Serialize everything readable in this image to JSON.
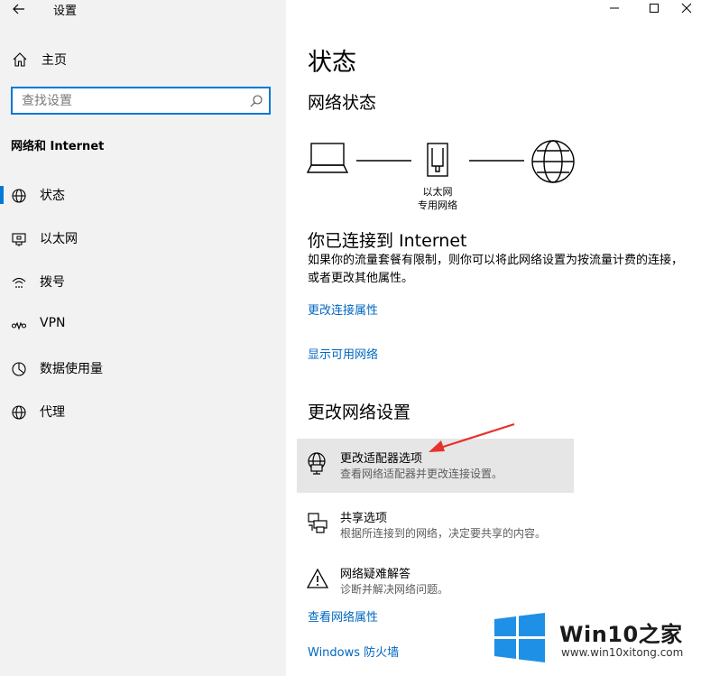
{
  "app": {
    "title": "设置"
  },
  "colors": {
    "accent": "#0078d7",
    "link": "#0067c0",
    "sidebar_bg": "#f2f2f2",
    "highlight_bg": "#e6e6e6",
    "arrow": "#e5322d"
  },
  "sidebar": {
    "home_label": "主页",
    "search_placeholder": "查找设置",
    "section_title": "网络和 Internet",
    "items": [
      {
        "label": "状态",
        "icon": "globe-status-icon",
        "selected": true
      },
      {
        "label": "以太网",
        "icon": "ethernet-monitor-icon",
        "selected": false
      },
      {
        "label": "拨号",
        "icon": "dial-up-icon",
        "selected": false
      },
      {
        "label": "VPN",
        "icon": "vpn-icon",
        "selected": false
      },
      {
        "label": "数据使用量",
        "icon": "data-usage-icon",
        "selected": false
      },
      {
        "label": "代理",
        "icon": "globe-proxy-icon",
        "selected": false
      }
    ]
  },
  "main": {
    "title": "状态",
    "network_status_heading": "网络状态",
    "diagram": {
      "adapter_name": "以太网",
      "network_name": "专用网络"
    },
    "connected_heading": "你已连接到 Internet",
    "connected_description": "如果你的流量套餐有限制，则你可以将此网络设置为按流量计费的连接，或者更改其他属性。",
    "link_change_connection_properties": "更改连接属性",
    "link_show_available_networks": "显示可用网络",
    "change_settings_heading": "更改网络设置",
    "options": [
      {
        "title": "更改适配器选项",
        "description": "查看网络适配器并更改连接设置。",
        "icon": "adapter-globe-icon"
      },
      {
        "title": "共享选项",
        "description": "根据所连接到的网络，决定要共享的内容。",
        "icon": "sharing-printer-icon"
      },
      {
        "title": "网络疑难解答",
        "description": "诊断并解决网络问题。",
        "icon": "warning-triangle-icon"
      }
    ],
    "link_view_network_properties": "查看网络属性",
    "link_windows_firewall": "Windows 防火墙"
  },
  "watermark": {
    "brand": "Win10之家",
    "url": "www.win10xitong.com"
  }
}
